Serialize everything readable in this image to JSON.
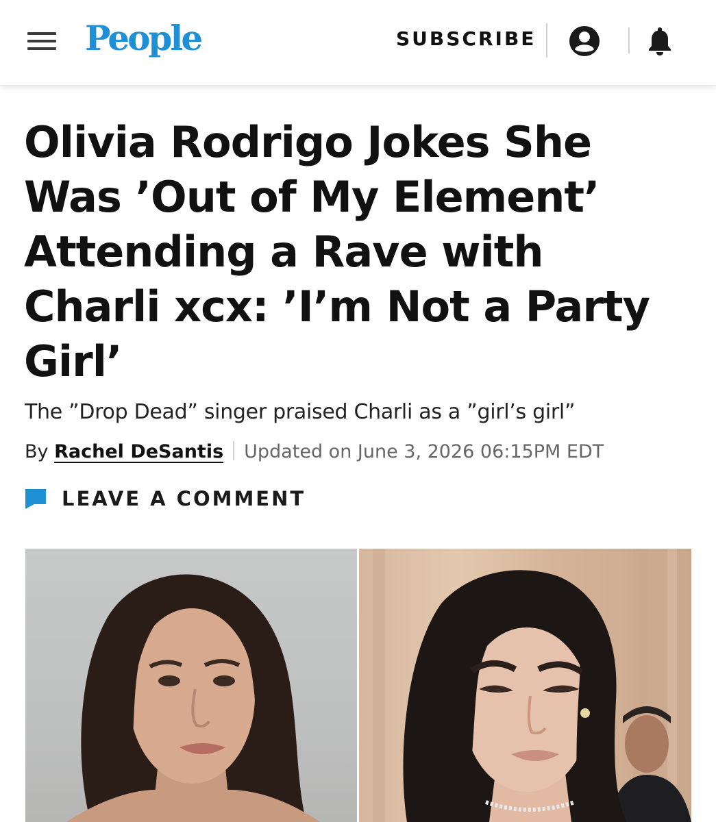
{
  "header": {
    "logo": "People",
    "subscribe_label": "SUBSCRIBE",
    "icons": [
      "menu-icon",
      "user-icon",
      "bell-icon"
    ]
  },
  "article": {
    "headline": "Olivia Rodrigo Jokes She Was ’Out of My Element’ Attending a Rave with Charli xcx: ’I’m Not a Party Girl’",
    "dek": "The ”Drop Dead” singer praised Charli as a ”girl’s girl”",
    "byline_prefix": "By",
    "author": "Rachel DeSantis",
    "updated": "Updated on June 3, 2026 06:15PM EDT",
    "comment_label": "LEAVE A COMMENT"
  },
  "colors": {
    "logo_blue": "#1f8fd6",
    "comment_icon_blue": "#1f8fd6",
    "text": "#111111"
  }
}
